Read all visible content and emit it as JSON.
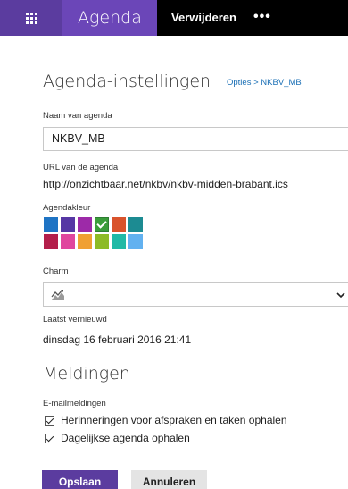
{
  "header": {
    "app_name": "Agenda",
    "delete_label": "Verwijderen",
    "more_label": "•••"
  },
  "page": {
    "title": "Agenda-instellingen",
    "breadcrumb_link": "Opties",
    "breadcrumb_separator": " > ",
    "breadcrumb_current": "NKBV_MB"
  },
  "name": {
    "label": "Naam van agenda",
    "value": "NKBV_MB"
  },
  "url": {
    "label": "URL van de agenda",
    "value": "http://onzichtbaar.net/nkbv/nkbv-midden-brabant.ics"
  },
  "colors": {
    "label": "Agendakleur",
    "selected_index": 3,
    "swatches": [
      "#1f74c4",
      "#5637a4",
      "#9d2aa8",
      "#3a9c3a",
      "#d9532c",
      "#1c8b92",
      "#b31f4b",
      "#e0469e",
      "#f0a033",
      "#8dbb25",
      "#20b9a6",
      "#62b1f0"
    ]
  },
  "charm": {
    "label": "Charm",
    "icon": "mountain-chart-icon"
  },
  "refreshed": {
    "label": "Laatst vernieuwd",
    "value": "dinsdag 16 februari 2016 21:41"
  },
  "notifications": {
    "title": "Meldingen",
    "email_label": "E-mailmeldingen",
    "options": [
      {
        "label": "Herinneringen voor afspraken en taken ophalen",
        "checked": true
      },
      {
        "label": "Dagelijkse agenda ophalen",
        "checked": true
      }
    ]
  },
  "actions": {
    "save_label": "Opslaan",
    "cancel_label": "Annuleren"
  }
}
